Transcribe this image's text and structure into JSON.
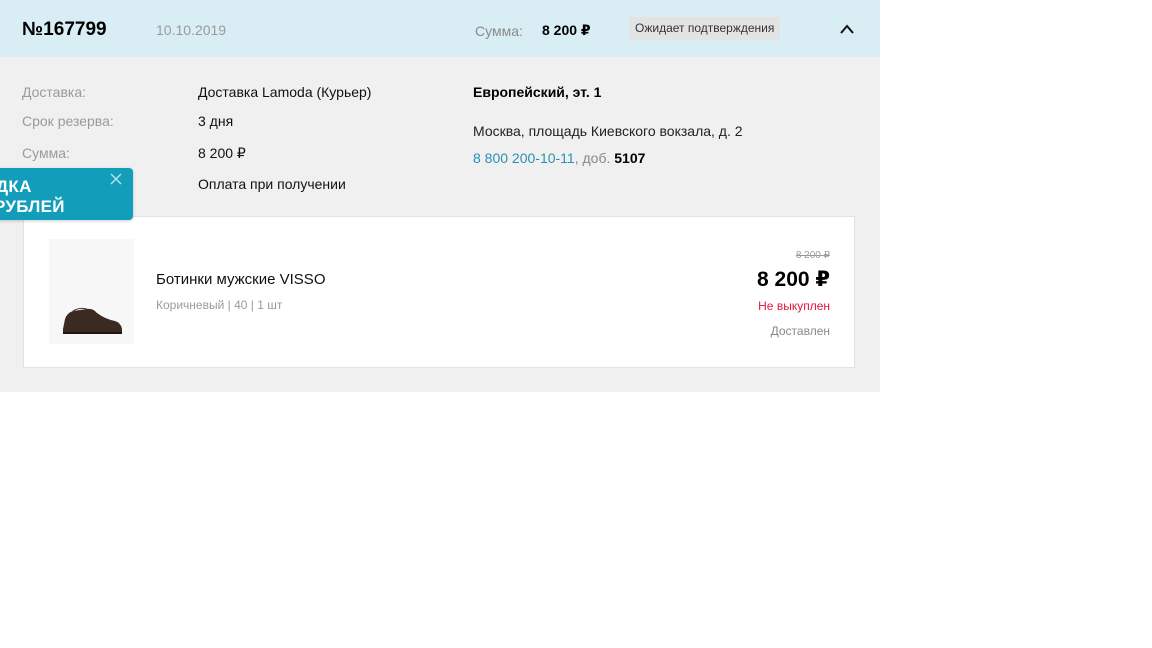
{
  "order": {
    "number": "№167799",
    "date": "10.10.2019",
    "sum_label": "Сумма:",
    "sum_value": "8 200 ₽",
    "status": "Ожидает подтверждения"
  },
  "details": [
    {
      "label": "Доставка:",
      "value": "Доставка Lamoda (Курьер)"
    },
    {
      "label": "Срок резерва:",
      "value": "3 дня"
    },
    {
      "label": "Сумма:",
      "value": "8 200 ₽"
    },
    {
      "label": "",
      "value": "Оплата при получении"
    }
  ],
  "store": {
    "name": "Европейский, эт. 1",
    "address": "Москва, площадь Киевского вокзала, д. 2",
    "phone": "8 800 200-10-11",
    "ext_prefix": ", доб.",
    "ext": "5107"
  },
  "item": {
    "name": "Ботинки мужские VISSO",
    "color": "Коричневый",
    "size": "40",
    "qty": "1 шт",
    "old_price": "8 200 ₽",
    "price": "8 200 ₽",
    "status_red": "Не выкуплен",
    "status_gray": "Доставлен",
    "image_icon": "brown-boot-icon"
  },
  "promo": {
    "line1": "ДКА",
    "line2": "РУБЛЕЙ"
  },
  "colors": {
    "header_bg": "#d8eef4",
    "panel_bg": "#f0f0f0",
    "link": "#2b8fb5",
    "alert": "#e0163c",
    "promo_bg": "#129dbb"
  }
}
